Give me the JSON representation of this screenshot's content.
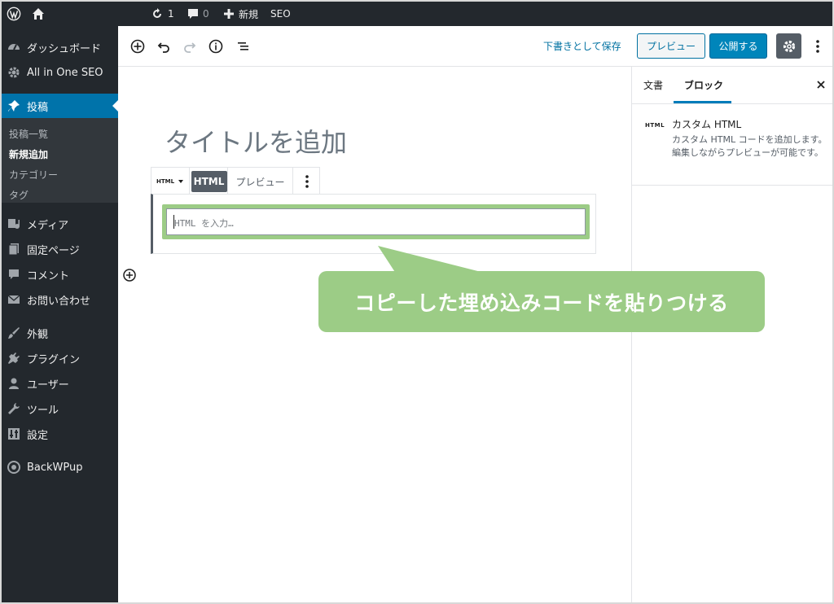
{
  "adminbar": {
    "updates_count": "1",
    "comments_count": "0",
    "new_label": "新規",
    "seo_label": "SEO"
  },
  "sidebar": {
    "items": [
      {
        "label": "ダッシュボード",
        "icon": "dashboard-icon"
      },
      {
        "label": "All in One SEO",
        "icon": "gear-icon"
      },
      {
        "label": "投稿",
        "icon": "pin-icon",
        "active": true
      },
      {
        "label": "メディア",
        "icon": "media-icon"
      },
      {
        "label": "固定ページ",
        "icon": "page-icon"
      },
      {
        "label": "コメント",
        "icon": "comment-icon"
      },
      {
        "label": "お問い合わせ",
        "icon": "mail-icon"
      },
      {
        "label": "外観",
        "icon": "brush-icon"
      },
      {
        "label": "プラグイン",
        "icon": "plugin-icon"
      },
      {
        "label": "ユーザー",
        "icon": "user-icon"
      },
      {
        "label": "ツール",
        "icon": "wrench-icon"
      },
      {
        "label": "設定",
        "icon": "settings-icon"
      },
      {
        "label": "BackWPup",
        "icon": "backwpup-icon"
      }
    ],
    "submenu": [
      {
        "label": "投稿一覧"
      },
      {
        "label": "新規追加",
        "current": true
      },
      {
        "label": "カテゴリー"
      },
      {
        "label": "タグ"
      }
    ]
  },
  "toolbar": {
    "save_draft_label": "下書きとして保存",
    "preview_label": "プレビュー",
    "publish_label": "公開する"
  },
  "panel": {
    "tab_document": "文書",
    "tab_block": "ブロック",
    "block_icon_text": "HTML",
    "block_title": "カスタム HTML",
    "block_description": "カスタム HTML コードを追加します。編集しながらプレビューが可能です。"
  },
  "editor": {
    "title_placeholder": "タイトルを追加",
    "switcher_label": "HTML",
    "html_tab_label": "HTML",
    "preview_tab_label": "プレビュー",
    "html_placeholder": "HTML を入力…"
  },
  "annotation": {
    "text": "コピーした埋め込みコードを貼りつける",
    "color": "#9ccc86"
  }
}
